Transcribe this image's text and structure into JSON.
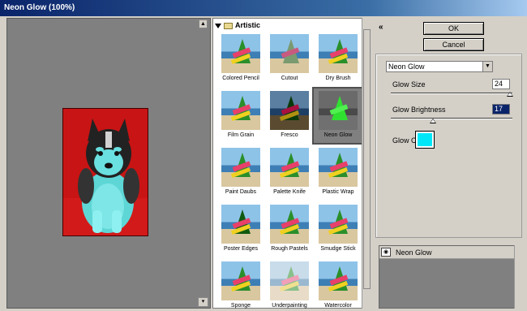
{
  "window": {
    "title": "Neon Glow (100%)"
  },
  "gallery": {
    "category": "Artistic",
    "filters": [
      "Colored Pencil",
      "Cutout",
      "Dry Brush",
      "Film Grain",
      "Fresco",
      "Neon Glow",
      "Paint Daubs",
      "Palette Knife",
      "Plastic Wrap",
      "Poster Edges",
      "Rough Pastels",
      "Smudge Stick",
      "Sponge",
      "Underpainting",
      "Watercolor"
    ],
    "selected": "Neon Glow"
  },
  "buttons": {
    "ok": "OK",
    "cancel": "Cancel"
  },
  "settings": {
    "filter_select": "Neon Glow",
    "glow_size_label": "Glow Size",
    "glow_size_value": "24",
    "glow_brightness_label": "Glow Brightness",
    "glow_brightness_value": "17",
    "glow_color_label": "Glow Color",
    "glow_color": "#00e8f8"
  },
  "layers": {
    "items": [
      "Neon Glow"
    ]
  },
  "icons": {
    "collapse": "double-chevron-up-icon",
    "eye": "eye-icon",
    "folder": "folder-icon"
  }
}
